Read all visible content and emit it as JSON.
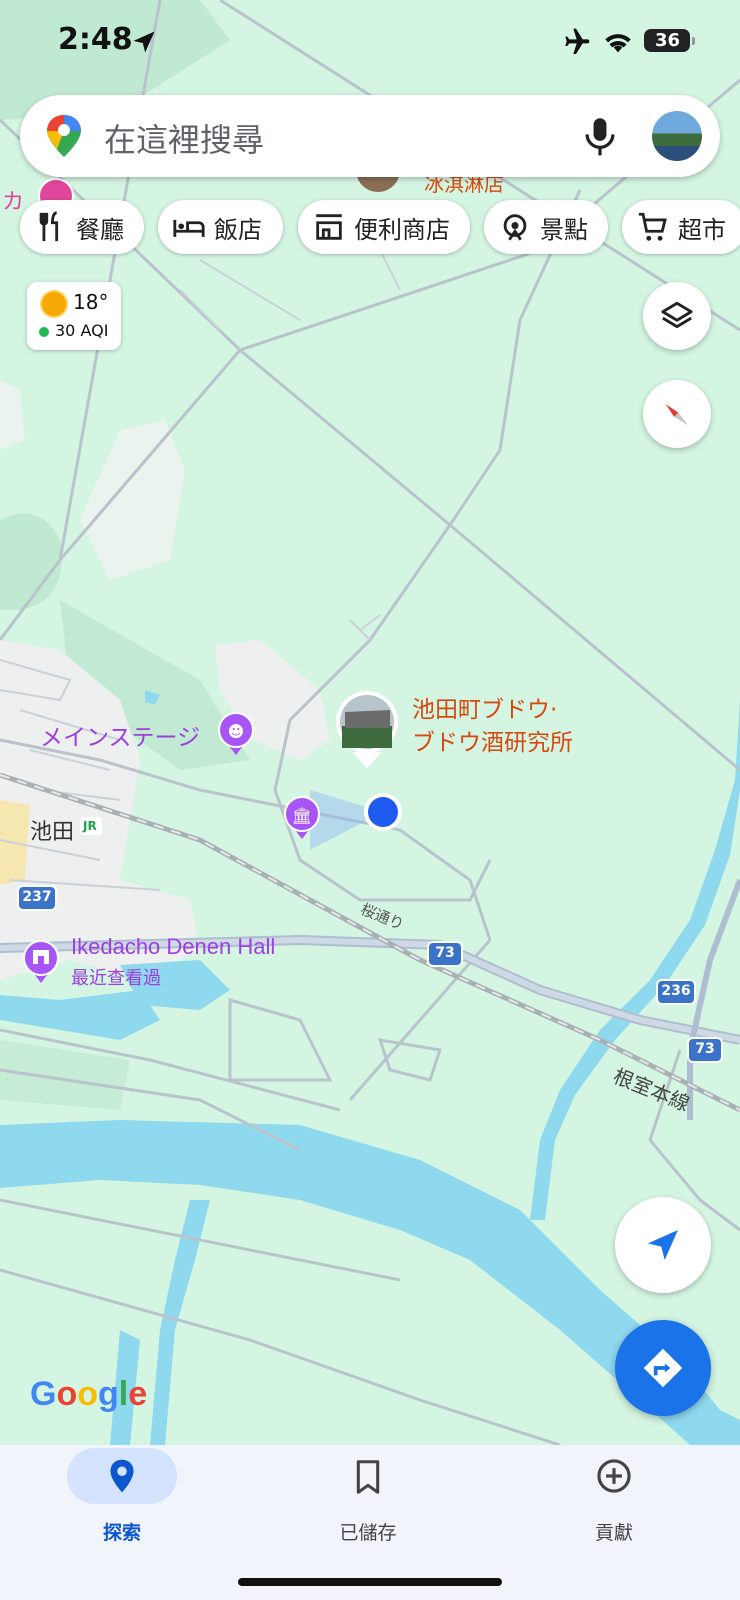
{
  "status_bar": {
    "time": "2:48",
    "battery": "36"
  },
  "search": {
    "placeholder": "在這裡搜尋"
  },
  "chips": [
    {
      "label": "餐廳",
      "icon": "restaurant-icon"
    },
    {
      "label": "飯店",
      "icon": "hotel-icon"
    },
    {
      "label": "便利商店",
      "icon": "store-icon"
    },
    {
      "label": "景點",
      "icon": "attraction-icon"
    },
    {
      "label": "超市",
      "icon": "cart-icon"
    }
  ],
  "weather": {
    "temperature": "18°",
    "aqi": "30 AQI"
  },
  "map": {
    "labels": {
      "top_left_partial": "カ",
      "top_partial": "冰淇淋店",
      "winery_line1": "池田町ブドウ·",
      "winery_line2": "ブドウ酒研究所",
      "main_stage": "メインステージ",
      "ikeda": "池田",
      "jr": "JR",
      "hall": "Ikedacho Denen Hall",
      "recent": "最近查看過",
      "sakura_street": "桜通り",
      "nemuro_line": "根室本線",
      "route_237": "237",
      "route_73a": "73",
      "route_73b": "73",
      "route_236": "236"
    }
  },
  "google_logo": "Google",
  "bottom_nav": [
    {
      "label": "探索",
      "icon": "explore-pin-icon",
      "active": true
    },
    {
      "label": "已儲存",
      "icon": "bookmark-icon",
      "active": false
    },
    {
      "label": "貢獻",
      "icon": "add-circle-icon",
      "active": false
    }
  ],
  "colors": {
    "map_bg": "#d4f5e2",
    "accent": "#1a73e8",
    "poi_purple": "#a855f7",
    "poi_orange": "#d9480f",
    "water": "#8fd9ee"
  }
}
